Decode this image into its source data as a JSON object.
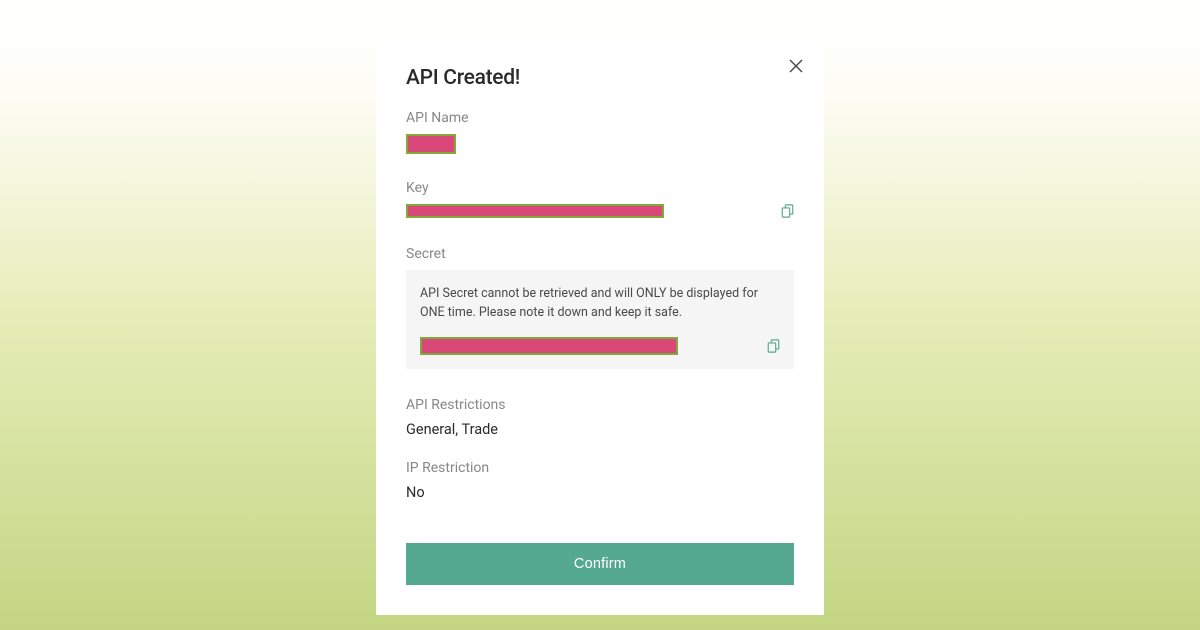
{
  "modal": {
    "title": "API Created!",
    "fields": {
      "api_name": {
        "label": "API Name"
      },
      "key": {
        "label": "Key"
      },
      "secret": {
        "label": "Secret",
        "warning": "API Secret cannot be retrieved and will ONLY be displayed for ONE time. Please note it down and keep it safe."
      },
      "api_restrictions": {
        "label": "API Restrictions",
        "value": "General, Trade"
      },
      "ip_restriction": {
        "label": "IP Restriction",
        "value": "No"
      }
    },
    "confirm_label": "Confirm"
  }
}
